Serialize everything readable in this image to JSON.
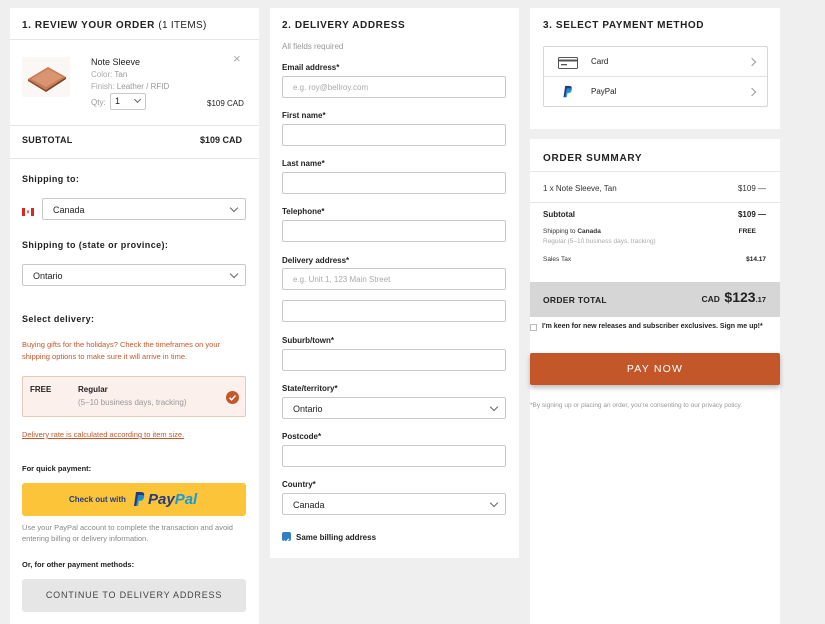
{
  "review": {
    "heading": "1. REVIEW YOUR ORDER",
    "items_count": "(1 ITEMS)",
    "product": {
      "name": "Note Sleeve",
      "color_label": "Color:",
      "color_value": "Tan",
      "finish_label": "Finish:",
      "finish_value": "Leather / RFID",
      "qty_label": "Qty:",
      "qty_value": "1",
      "price": "$109 CAD",
      "remove_glyph": "×"
    },
    "subtotal_label": "SUBTOTAL",
    "subtotal_value": "$109 CAD",
    "shipping_to_label": "Shipping to:",
    "country_value": "Canada",
    "state_label": "Shipping to (state or province):",
    "state_value": "Ontario",
    "delivery_label": "Select delivery:",
    "holiday_note": "Buying gifts for the holidays? Check the timeframes on your shipping options to make sure it will arrive in time.",
    "delivery_option": {
      "price": "FREE",
      "name": "Regular",
      "detail": "(5–10 business days, tracking)"
    },
    "delivery_rate_link": "Delivery rate is calculated according to item size.",
    "quick_payment_label": "For quick payment:",
    "paypal_button_prefix": "Check out with",
    "paypal_button_brand_pay": "Pay",
    "paypal_button_brand_pal": "Pal",
    "paypal_note": "Use your PayPal account to complete the transaction and avoid entering billing or delivery information.",
    "other_methods_label": "Or, for other payment methods:",
    "continue_button": "CONTINUE TO DELIVERY ADDRESS"
  },
  "delivery": {
    "heading": "2. DELIVERY ADDRESS",
    "required_note": "All fields required",
    "email_label": "Email address*",
    "email_placeholder": "e.g. roy@bellroy.com",
    "first_name_label": "First name*",
    "last_name_label": "Last name*",
    "telephone_label": "Telephone*",
    "address_label": "Delivery address*",
    "address_placeholder": "e.g. Unit 1, 123 Main Street",
    "suburb_label": "Suburb/town*",
    "state_label": "State/territory*",
    "state_value": "Ontario",
    "postcode_label": "Postcode*",
    "country_label": "Country*",
    "country_value": "Canada",
    "same_billing_label": "Same billing address"
  },
  "payment": {
    "heading": "3. SELECT PAYMENT METHOD",
    "methods": [
      {
        "label": "Card",
        "icon": "card-icon"
      },
      {
        "label": "PayPal",
        "icon": "paypal-icon"
      }
    ]
  },
  "summary": {
    "heading": "ORDER SUMMARY",
    "line_item": "1 x Note Sleeve, Tan",
    "line_item_price": "$109",
    "line_item_minus": "—",
    "subtotal_label": "Subtotal",
    "subtotal_value": "$109",
    "subtotal_minus": "—",
    "shipping_label": "Shipping to",
    "shipping_country": "Canada",
    "shipping_detail": "Regular (5–10 business days, tracking)",
    "shipping_value": "FREE",
    "tax_label": "Sales Tax",
    "tax_value": "$14.17",
    "total_label": "ORDER TOTAL",
    "total_currency": "CAD",
    "total_main": "$123",
    "total_cents": ".17",
    "newsletter_label": "I'm keen for new releases and subscriber exclusives. Sign me up!*",
    "pay_button": "PAY NOW",
    "consent_note": "*By signing up or placing an order, you're consenting to our privacy policy."
  },
  "colors": {
    "accent": "#c4572a",
    "paypal_yellow": "#fcc439",
    "paypal_blue": "#253b80",
    "paypal_light_blue": "#179bd7",
    "total_bg": "#d6d6d6",
    "check_blue": "#2f7fc1"
  }
}
